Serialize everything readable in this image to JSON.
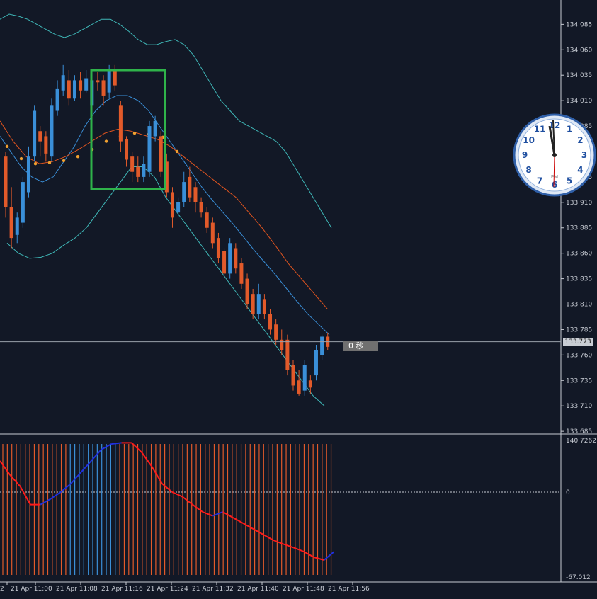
{
  "chart_data": [
    {
      "type": "candlestick",
      "symbol_pane": "main",
      "y_ticks": [
        "134.085",
        "134.060",
        "134.035",
        "134.010",
        "133.985",
        "133.960",
        "133.935",
        "133.910",
        "133.885",
        "133.860",
        "133.835",
        "133.810",
        "133.785",
        "133.760",
        "133.735",
        "133.710",
        "133.685"
      ],
      "x_ticks": [
        "2",
        "21 Apr 11:00",
        "21 Apr 11:08",
        "21 Apr 11:16",
        "21 Apr 11:24",
        "21 Apr 11:32",
        "21 Apr 11:40",
        "21 Apr 11:48",
        "21 Apr 11:56"
      ],
      "ylim": [
        133.683,
        134.095
      ],
      "current_price": "133.773",
      "countdown": "0 秒",
      "candles": [
        {
          "o": 133.955,
          "c": 133.905,
          "h": 133.96,
          "l": 133.895
        },
        {
          "o": 133.905,
          "c": 133.875,
          "h": 133.925,
          "l": 133.865
        },
        {
          "o": 133.878,
          "c": 133.895,
          "h": 133.9,
          "l": 133.87
        },
        {
          "o": 133.89,
          "c": 133.93,
          "h": 133.935,
          "l": 133.885
        },
        {
          "o": 133.92,
          "c": 133.955,
          "h": 133.965,
          "l": 133.915
        },
        {
          "o": 133.955,
          "c": 134.0,
          "h": 134.005,
          "l": 133.95
        },
        {
          "o": 133.98,
          "c": 133.97,
          "h": 133.985,
          "l": 133.955
        },
        {
          "o": 133.975,
          "c": 133.958,
          "h": 133.98,
          "l": 133.95
        },
        {
          "o": 133.955,
          "c": 134.005,
          "h": 134.012,
          "l": 133.95
        },
        {
          "o": 134.0,
          "c": 134.022,
          "h": 134.03,
          "l": 133.995
        },
        {
          "o": 134.02,
          "c": 134.035,
          "h": 134.045,
          "l": 134.015
        },
        {
          "o": 134.03,
          "c": 134.012,
          "h": 134.04,
          "l": 134.005
        },
        {
          "o": 134.012,
          "c": 134.03,
          "h": 134.035,
          "l": 134.01
        },
        {
          "o": 134.03,
          "c": 134.02,
          "h": 134.038,
          "l": 134.012
        },
        {
          "o": 134.02,
          "c": 134.032,
          "h": 134.04,
          "l": 134.018
        },
        {
          "o": 134.005,
          "c": 134.03,
          "h": 134.035,
          "l": 134.0
        },
        {
          "o": 134.03,
          "c": 134.028,
          "h": 134.038,
          "l": 134.02
        },
        {
          "o": 134.03,
          "c": 134.015,
          "h": 134.035,
          "l": 134.005
        },
        {
          "o": 134.018,
          "c": 134.04,
          "h": 134.045,
          "l": 134.012
        },
        {
          "o": 134.04,
          "c": 134.025,
          "h": 134.045,
          "l": 134.02
        },
        {
          "o": 134.005,
          "c": 133.97,
          "h": 134.01,
          "l": 133.96
        },
        {
          "o": 133.972,
          "c": 133.952,
          "h": 133.975,
          "l": 133.945
        },
        {
          "o": 133.955,
          "c": 133.94,
          "h": 133.96,
          "l": 133.93
        },
        {
          "o": 133.945,
          "c": 133.935,
          "h": 133.955,
          "l": 133.93
        },
        {
          "o": 133.935,
          "c": 133.948,
          "h": 133.955,
          "l": 133.93
        },
        {
          "o": 133.94,
          "c": 133.985,
          "h": 133.99,
          "l": 133.935
        },
        {
          "o": 133.975,
          "c": 133.99,
          "h": 133.995,
          "l": 133.97
        },
        {
          "o": 133.975,
          "c": 133.94,
          "h": 133.98,
          "l": 133.935
        },
        {
          "o": 133.95,
          "c": 133.92,
          "h": 133.958,
          "l": 133.915
        },
        {
          "o": 133.92,
          "c": 133.895,
          "h": 133.925,
          "l": 133.885
        },
        {
          "o": 133.9,
          "c": 133.91,
          "h": 133.915,
          "l": 133.895
        },
        {
          "o": 133.91,
          "c": 133.93,
          "h": 133.94,
          "l": 133.905
        },
        {
          "o": 133.935,
          "c": 133.915,
          "h": 133.945,
          "l": 133.91
        },
        {
          "o": 133.925,
          "c": 133.91,
          "h": 133.93,
          "l": 133.9
        },
        {
          "o": 133.91,
          "c": 133.9,
          "h": 133.915,
          "l": 133.895
        },
        {
          "o": 133.9,
          "c": 133.885,
          "h": 133.905,
          "l": 133.88
        },
        {
          "o": 133.89,
          "c": 133.87,
          "h": 133.895,
          "l": 133.865
        },
        {
          "o": 133.875,
          "c": 133.855,
          "h": 133.88,
          "l": 133.85
        },
        {
          "o": 133.862,
          "c": 133.84,
          "h": 133.865,
          "l": 133.835
        },
        {
          "o": 133.84,
          "c": 133.87,
          "h": 133.875,
          "l": 133.835
        },
        {
          "o": 133.865,
          "c": 133.845,
          "h": 133.87,
          "l": 133.84
        },
        {
          "o": 133.85,
          "c": 133.83,
          "h": 133.855,
          "l": 133.825
        },
        {
          "o": 133.835,
          "c": 133.81,
          "h": 133.84,
          "l": 133.805
        },
        {
          "o": 133.82,
          "c": 133.8,
          "h": 133.825,
          "l": 133.795
        },
        {
          "o": 133.8,
          "c": 133.82,
          "h": 133.83,
          "l": 133.795
        },
        {
          "o": 133.815,
          "c": 133.8,
          "h": 133.82,
          "l": 133.795
        },
        {
          "o": 133.8,
          "c": 133.785,
          "h": 133.805,
          "l": 133.78
        },
        {
          "o": 133.79,
          "c": 133.775,
          "h": 133.795,
          "l": 133.77
        },
        {
          "o": 133.775,
          "c": 133.765,
          "h": 133.785,
          "l": 133.76
        },
        {
          "o": 133.775,
          "c": 133.745,
          "h": 133.78,
          "l": 133.74
        },
        {
          "o": 133.75,
          "c": 133.73,
          "h": 133.755,
          "l": 133.725
        },
        {
          "o": 133.735,
          "c": 133.722,
          "h": 133.745,
          "l": 133.72
        },
        {
          "o": 133.725,
          "c": 133.75,
          "h": 133.755,
          "l": 133.72
        },
        {
          "o": 133.735,
          "c": 133.728,
          "h": 133.74,
          "l": 133.722
        },
        {
          "o": 133.74,
          "c": 133.765,
          "h": 133.77,
          "l": 133.735
        },
        {
          "o": 133.76,
          "c": 133.778,
          "h": 133.78,
          "l": 133.755
        },
        {
          "o": 133.778,
          "c": 133.768,
          "h": 133.782,
          "l": 133.765
        }
      ],
      "bands": {
        "upper": [
          134.09,
          134.095,
          134.093,
          134.09,
          134.085,
          134.08,
          134.075,
          134.072,
          134.075,
          134.08,
          134.085,
          134.09,
          134.09,
          134.085,
          134.078,
          134.07,
          134.065,
          134.065,
          134.068,
          134.07,
          134.065,
          134.055,
          134.04,
          134.025,
          134.01,
          134.0,
          133.99,
          133.985,
          133.98,
          133.975,
          133.97,
          133.96,
          133.945,
          133.93,
          133.915,
          133.9,
          133.885
        ],
        "middle": [
          133.975,
          133.96,
          133.945,
          133.935,
          133.93,
          133.935,
          133.95,
          133.965,
          133.985,
          134.0,
          134.01,
          134.015,
          134.015,
          134.01,
          134.0,
          133.985,
          133.97,
          133.955,
          133.94,
          133.925,
          133.912,
          133.9,
          133.888,
          133.875,
          133.862,
          133.85,
          133.838,
          133.825,
          133.812,
          133.8,
          133.79,
          133.78
        ],
        "lower": [
          133.87,
          133.86,
          133.855,
          133.856,
          133.86,
          133.868,
          133.875,
          133.885,
          133.9,
          133.915,
          133.93,
          133.945,
          133.945,
          133.935,
          133.915,
          133.9,
          133.885,
          133.87,
          133.855,
          133.84,
          133.825,
          133.81,
          133.795,
          133.78,
          133.765,
          133.75,
          133.735,
          133.72,
          133.71
        ]
      },
      "ma": [
        133.99,
        133.97,
        133.955,
        133.948,
        133.95,
        133.955,
        133.962,
        133.97,
        133.978,
        133.982,
        133.98,
        133.976,
        133.972,
        133.965,
        133.955,
        133.945,
        133.935,
        133.925,
        133.915,
        133.9,
        133.885,
        133.868,
        133.85,
        133.835,
        133.82,
        133.805
      ],
      "ma_dots": [
        133.965,
        133.953,
        133.948,
        133.949,
        133.951,
        133.955,
        133.962,
        133.97,
        133.975,
        133.978,
        133.977,
        133.974,
        133.96
      ],
      "highlight_box": {
        "color": "#2fb34a"
      }
    },
    {
      "type": "histogram",
      "symbol_pane": "sub",
      "y_ticks": [
        "140.7262",
        "0",
        "-67.012"
      ],
      "bar_colors": {
        "up": "#3a8fd8",
        "down": "#e25a2a"
      },
      "bars": [
        "down",
        "down",
        "down",
        "down",
        "down",
        "down",
        "down",
        "down",
        "down",
        "down",
        "down",
        "down",
        "down",
        "down",
        "down",
        "up",
        "up",
        "up",
        "up",
        "up",
        "up",
        "up",
        "up",
        "up",
        "up",
        "up",
        "down",
        "down",
        "down",
        "down",
        "down",
        "down",
        "down",
        "down",
        "down",
        "down",
        "down",
        "down",
        "down",
        "down",
        "down",
        "down",
        "down",
        "down",
        "down",
        "down",
        "down",
        "down",
        "down",
        "down",
        "down",
        "down",
        "down",
        "down",
        "down",
        "down",
        "down",
        "down",
        "down",
        "down",
        "down",
        "down",
        "down",
        "down",
        "down",
        "down",
        "down",
        "down",
        "down",
        "down",
        "down",
        "down",
        "down",
        "down"
      ],
      "line": [
        0.55,
        0.3,
        0.1,
        -0.22,
        -0.22,
        -0.12,
        0.0,
        0.15,
        0.35,
        0.55,
        0.75,
        0.85,
        0.87,
        0.87,
        0.7,
        0.45,
        0.15,
        0.0,
        -0.08,
        -0.22,
        -0.35,
        -0.42,
        -0.35,
        -0.45,
        -0.55,
        -0.65,
        -0.75,
        -0.85,
        -0.92,
        -0.98,
        -1.05,
        -1.15,
        -1.2,
        -1.05
      ]
    }
  ]
}
